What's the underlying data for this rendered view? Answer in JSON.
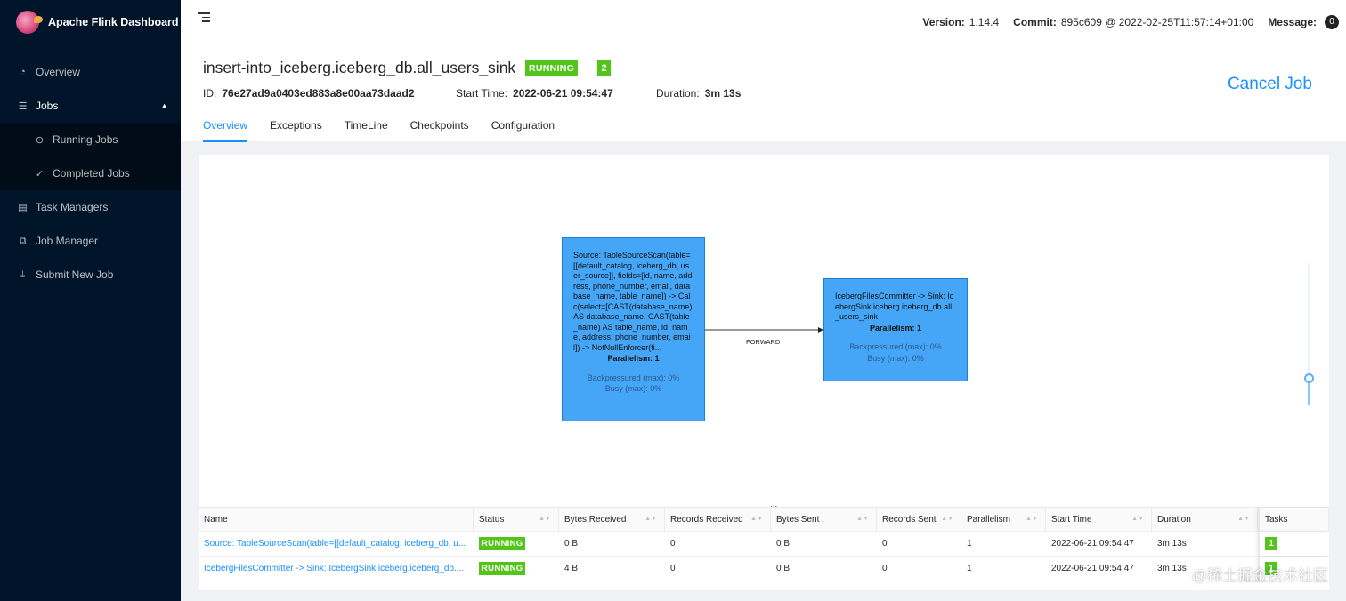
{
  "app": {
    "title": "Apache Flink Dashboard"
  },
  "sidebar": {
    "overview": "Overview",
    "jobs": "Jobs",
    "running_jobs": "Running Jobs",
    "completed_jobs": "Completed Jobs",
    "task_managers": "Task Managers",
    "job_manager": "Job Manager",
    "submit_new_job": "Submit New Job"
  },
  "header": {
    "version_label": "Version:",
    "version": "1.14.4",
    "commit_label": "Commit:",
    "commit": "895c609 @ 2022-02-25T11:57:14+01:00",
    "message_label": "Message:",
    "message_count": "0"
  },
  "job": {
    "name": "insert-into_iceberg.iceberg_db.all_users_sink",
    "status": "RUNNING",
    "tasks": "2",
    "id_label": "ID:",
    "id": "76e27ad9a0403ed883a8e00aa73daad2",
    "start_label": "Start Time:",
    "start_time": "2022-06-21 09:54:47",
    "duration_label": "Duration:",
    "duration": "3m 13s",
    "cancel_label": "Cancel Job"
  },
  "tabs": [
    "Overview",
    "Exceptions",
    "TimeLine",
    "Checkpoints",
    "Configuration"
  ],
  "graph": {
    "source_node": {
      "description": "Source: TableSourceScan(table=[[default_catalog, iceberg_db, user_source]], fields=[id, name, address, phone_number, email, database_name, table_name]) -> Calc(select=[CAST(database_name) AS database_name, CAST(table_name) AS table_name, id, name, address, phone_number, email]) -> NotNullEnforcer(fi...",
      "parallelism": "Parallelism: 1",
      "backpressured": "Backpressured (max): 0%",
      "busy": "Busy (max): 0%"
    },
    "sink_node": {
      "description": "IcebergFilesCommitter -> Sink: IcebergSink iceberg.iceberg_db.all_users_sink",
      "parallelism": "Parallelism: 1",
      "backpressured": "Backpressured (max): 0%",
      "busy": "Busy (max): 0%"
    },
    "edge_label": "FORWARD",
    "drag_handle": "..."
  },
  "table": {
    "headers": [
      "Name",
      "Status",
      "Bytes Received",
      "Records Received",
      "Bytes Sent",
      "Records Sent",
      "Parallelism",
      "Start Time",
      "Duration",
      "Tasks"
    ],
    "rows": [
      {
        "name": "Source: TableSourceScan(table=[[default_catalog, iceberg_db, u...",
        "status": "RUNNING",
        "bytes_received": "0 B",
        "records_received": "0",
        "bytes_sent": "0 B",
        "records_sent": "0",
        "parallelism": "1",
        "start_time": "2022-06-21 09:54:47",
        "duration": "3m 13s",
        "tasks": "1"
      },
      {
        "name": "IcebergFilesCommitter -> Sink: IcebergSink iceberg.iceberg_db....",
        "status": "RUNNING",
        "bytes_received": "4 B",
        "records_received": "0",
        "bytes_sent": "0 B",
        "records_sent": "0",
        "parallelism": "1",
        "start_time": "2022-06-21 09:54:47",
        "duration": "3m 13s",
        "tasks": "1"
      }
    ]
  },
  "watermark": "@稀土掘金技术社区",
  "colors": {
    "accent": "#1890ff",
    "running": "#52c41a",
    "sidebar": "#001529",
    "node": "#45a5f7"
  }
}
